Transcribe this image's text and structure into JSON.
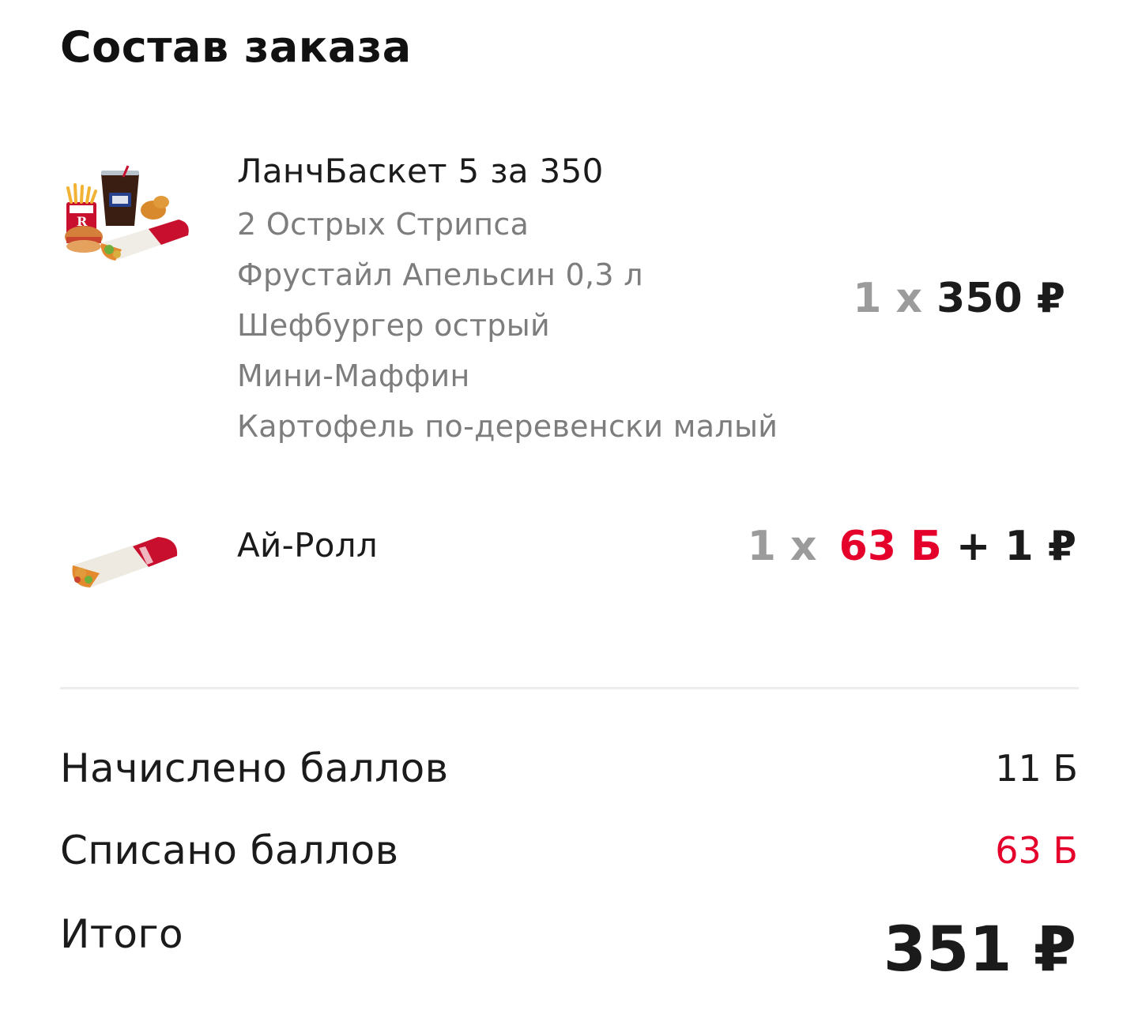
{
  "header": {
    "title": "Состав заказа"
  },
  "items": [
    {
      "name": "ЛанчБаскет 5 за 350",
      "image": "lunch-basket-combo-image",
      "components": [
        "2 Острых Стрипса",
        "Фрустайл Апельсин 0,3 л",
        "Шефбургер острый",
        "Мини-Маффин",
        "Картофель по-деревенски малый"
      ],
      "quantity": "1 x",
      "price": "350 ₽"
    },
    {
      "name": "Ай-Ролл",
      "image": "i-roll-wrap-image",
      "quantity": "1 x",
      "points": "63 Б",
      "plus": "+ 1 ₽"
    }
  ],
  "summary": {
    "accrued_label": "Начислено баллов",
    "accrued_value": "11 Б",
    "spent_label": "Списано баллов",
    "spent_value": "63 Б",
    "total_label": "Итого",
    "total_value": "351 ₽"
  },
  "colors": {
    "accent_red": "#e4002b",
    "muted_gray": "#7d7d7d",
    "text": "#1b1b1b",
    "divider": "#ececec"
  }
}
